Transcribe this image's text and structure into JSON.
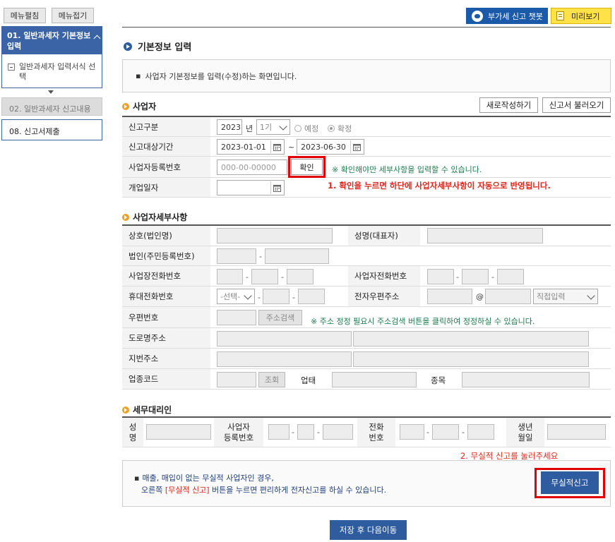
{
  "sidebar": {
    "expand_all": "메뉴펼침",
    "collapse_all": "메뉴접기",
    "step1": {
      "label": "01. 일반과세자 기본정보 입력"
    },
    "step1_sub": "일반과세자 입력서식 선택",
    "step2": "02. 일반과세자 신고내용",
    "step3": "08. 신고서제출"
  },
  "topbar": {
    "chatbot": "부가세 신고 챗봇",
    "preview": "미리보기"
  },
  "page": {
    "title": "기본정보 입력",
    "notice": "사업자 기본정보를 입력(수정)하는 화면입니다."
  },
  "business": {
    "section_title": "사업자",
    "new_button": "새로작성하기",
    "load_button": "신고서 불러오기",
    "report_type_label": "신고구분",
    "year": "2023",
    "year_unit": "년",
    "term": "1기",
    "radio_planned": "예정",
    "radio_final": "확정",
    "period_label": "신고대상기간",
    "period_start": "2023-01-01",
    "period_tilde": "~",
    "period_end": "2023-06-30",
    "reg_label": "사업자등록번호",
    "reg_placeholder": "000-00-00000",
    "confirm_button": "확인",
    "reg_hint": "※ 확인해야만 세부사항을 입력할 수 있습니다.",
    "open_date_label": "개업일자",
    "annotation1": "1. 확인을 누르면 하단에 사업자세부사항이 자동으로 반영됩니다."
  },
  "details": {
    "section_title": "사업자세부사항",
    "company_label": "상호(법인명)",
    "rep_label": "성명(대표자)",
    "corp_no_label": "법인(주민등록번호)",
    "biz_phone_label": "사업장전화번호",
    "owner_phone_label": "사업자전화번호",
    "mobile_label": "휴대전화번호",
    "mobile_select": "-선택-",
    "email_label": "전자우편주소",
    "email_at": "@",
    "email_domain_select": "직접입력",
    "zip_label": "우편번호",
    "zip_search": "주소검색",
    "zip_hint": "※ 주소 정정 필요시 주소검색 버튼을 클릭하여 정정하실 수 있습니다.",
    "road_label": "도로명주소",
    "lot_label": "지번주소",
    "industry_code_label": "업종코드",
    "lookup_button": "조회",
    "business_type_label": "업태",
    "item_label": "종목"
  },
  "agent": {
    "section_title": "세무대리인",
    "name_label_1": "성",
    "name_label_2": "명",
    "reg_label_1": "사업자",
    "reg_label_2": "등록번호",
    "phone_label_1": "전화",
    "phone_label_2": "번호",
    "birth_label_1": "생년",
    "birth_label_2": "월일"
  },
  "footer": {
    "annotation2": "2. 무실적 신고를 눌러주세요",
    "info_line1": "매출, 매입이 없는 무실적 사업자인 경우,",
    "info_line2_a": "오른쪽 ",
    "info_line2_b": "[무실적 신고]",
    "info_line2_c": " 버튼을 누르면 편리하게 전자신고를 하실 수 있습니다.",
    "no_performance_button": "무실적신고",
    "save_next_button": "저장 후 다음이동"
  },
  "colors": {
    "primary_blue": "#2f5c9e",
    "annotation_red": "#e0251b",
    "highlight_red": "#e00000",
    "hint_green": "#1c7a4e",
    "preview_yellow": "#ffe14a"
  }
}
